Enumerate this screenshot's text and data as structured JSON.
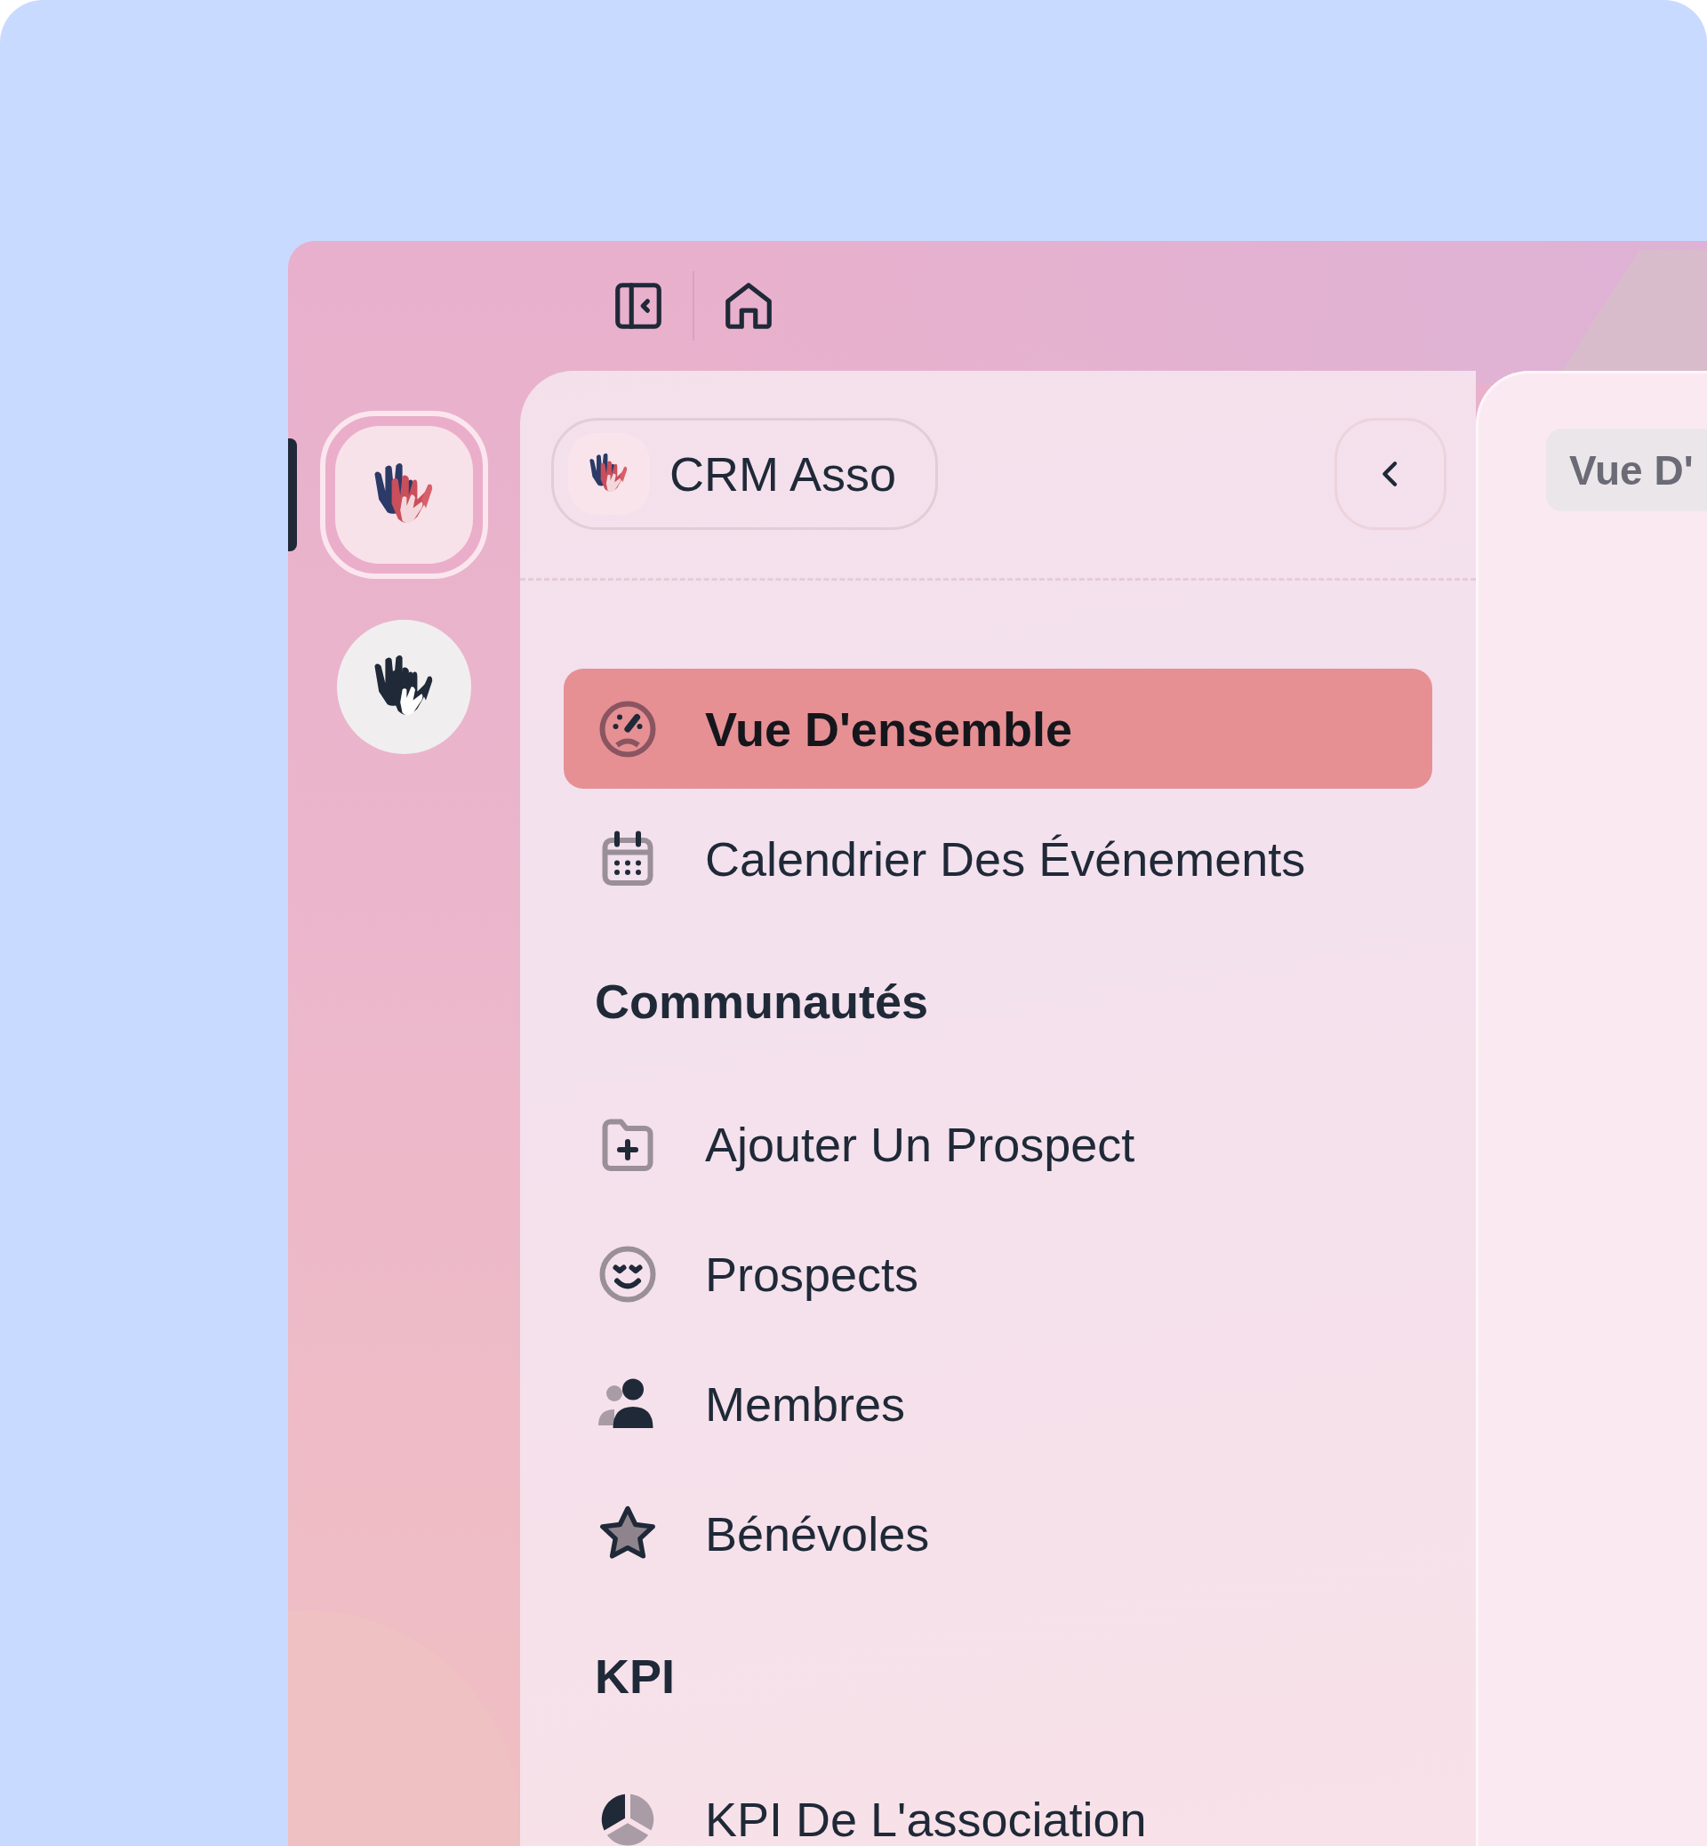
{
  "workspaces": [
    {
      "kind": "color",
      "selected": true
    },
    {
      "kind": "mono",
      "selected": false
    }
  ],
  "sidebar": {
    "workspace_name": "CRM Asso",
    "items": [
      {
        "kind": "link",
        "label": "Vue D'ensemble",
        "selected": true
      },
      {
        "kind": "link",
        "label": "Calendrier Des Événements",
        "selected": false
      },
      {
        "kind": "header",
        "label": "Communautés"
      },
      {
        "kind": "link",
        "label": "Ajouter Un Prospect",
        "selected": false
      },
      {
        "kind": "link",
        "label": "Prospects",
        "selected": false
      },
      {
        "kind": "link",
        "label": "Membres",
        "selected": false
      },
      {
        "kind": "link",
        "label": "Bénévoles",
        "selected": false
      },
      {
        "kind": "header",
        "label": "KPI"
      },
      {
        "kind": "link",
        "label": "KPI De L'association",
        "selected": false
      }
    ]
  },
  "main": {
    "title_chip": "Vue D'"
  }
}
